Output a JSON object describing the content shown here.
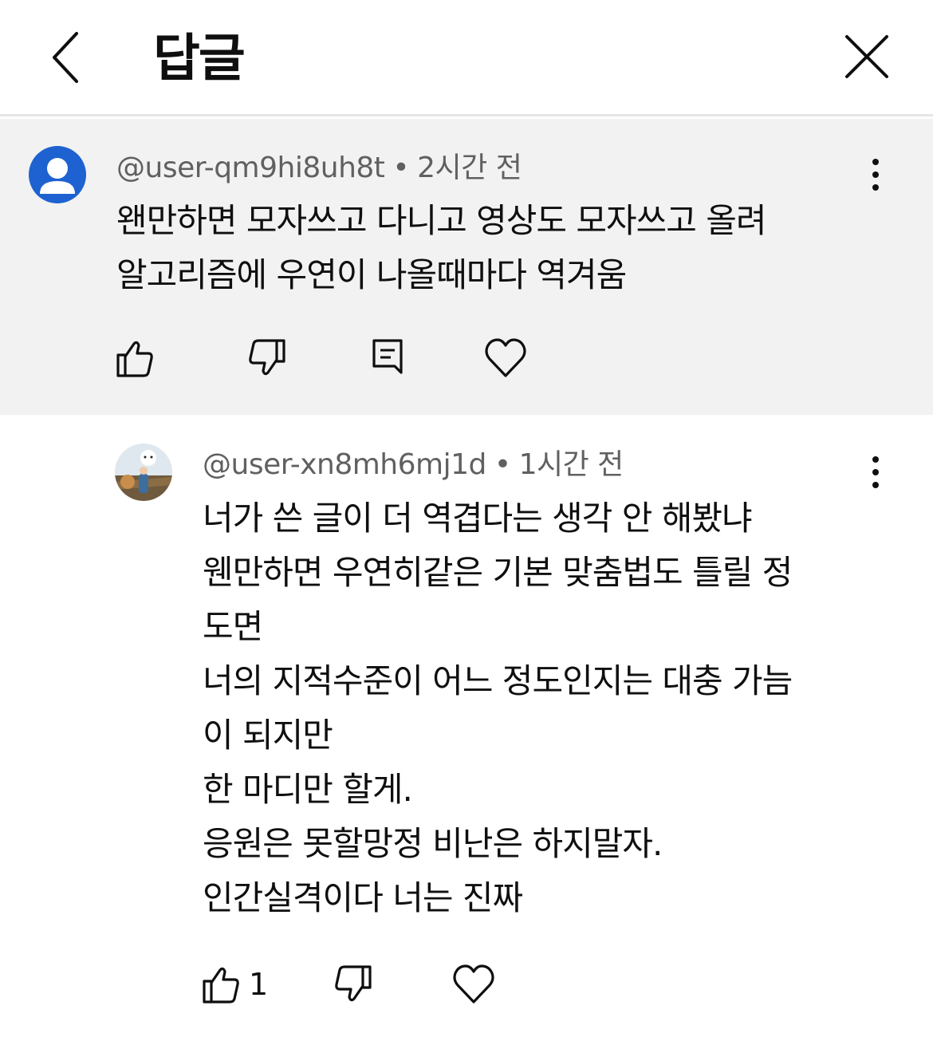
{
  "header": {
    "title": "답글"
  },
  "parent_comment": {
    "username": "@user-qm9hi8uh8t",
    "separator": "•",
    "time": "2시간 전",
    "lines": [
      "왠만하면 모자쓰고 다니고 영상도 모자쓰고 올려",
      "알고리즘에 우연이 나올때마다 역겨움"
    ],
    "icons": [
      "like-icon",
      "dislike-icon",
      "reply-icon",
      "heart-icon",
      "more-icon"
    ]
  },
  "reply_comment": {
    "username": "@user-xn8mh6mj1d",
    "separator": "•",
    "time": "1시간 전",
    "lines": [
      "너가 쓴 글이 더 역겹다는 생각 안 해봤냐",
      "웬만하면 우연히같은 기본 맞춤법도 틀릴 정",
      "도면",
      "너의 지적수준이 어느 정도인지는 대충 가늠",
      "이 되지만",
      "한 마디만 할게.",
      "응원은 못할망정 비난은 하지말자.",
      "인간실격이다 너는 진짜"
    ],
    "like_count": "1",
    "icons": [
      "like-icon",
      "dislike-icon",
      "heart-icon",
      "more-icon"
    ]
  },
  "colors": {
    "parent_bg": "#f2f2f2",
    "avatar_default": "#1d62d0",
    "meta_text": "#606060",
    "body_text": "#0f0f0f"
  }
}
